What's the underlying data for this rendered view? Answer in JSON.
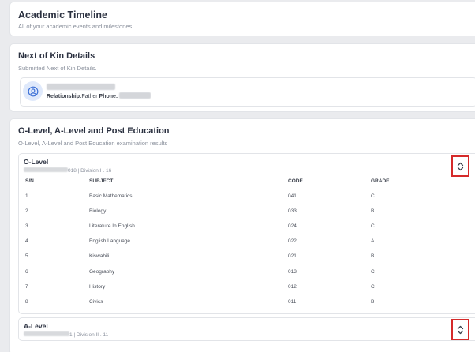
{
  "timeline": {
    "title": "Academic Timeline",
    "subtitle": "All of your academic events and milestones"
  },
  "kin": {
    "title": "Next of Kin Details",
    "subtitle": "Submitted Next of Kin Details.",
    "relationship_label": "Relationship:",
    "relationship_value": "Father",
    "phone_label": "Phone:",
    "icon": "user-circle-icon"
  },
  "education": {
    "title": "O-Level, A-Level and Post Education",
    "subtitle": "O-Level, A-Level and Post Education examination results",
    "olevel": {
      "title": "O-Level",
      "index_suffix": "018",
      "division_text": "| Division:I . 16",
      "headers": {
        "sn": "S/N",
        "subject": "SUBJECT",
        "code": "CODE",
        "grade": "GRADE"
      },
      "rows": [
        {
          "sn": "1",
          "subject": "Basic Mathematics",
          "code": "041",
          "grade": "C"
        },
        {
          "sn": "2",
          "subject": "Biology",
          "code": "033",
          "grade": "B"
        },
        {
          "sn": "3",
          "subject": "Literature In English",
          "code": "024",
          "grade": "C"
        },
        {
          "sn": "4",
          "subject": "English Language",
          "code": "022",
          "grade": "A"
        },
        {
          "sn": "5",
          "subject": "Kiswahili",
          "code": "021",
          "grade": "B"
        },
        {
          "sn": "6",
          "subject": "Geography",
          "code": "013",
          "grade": "C"
        },
        {
          "sn": "7",
          "subject": "History",
          "code": "012",
          "grade": "C"
        },
        {
          "sn": "8",
          "subject": "Civics",
          "code": "011",
          "grade": "B"
        }
      ]
    },
    "alevel": {
      "title": "A-Level",
      "index_suffix": "1",
      "division_text": "| Division:II . 11"
    }
  },
  "colors": {
    "highlight_border": "#d52a2a",
    "avatar_bg": "#dfe9fb",
    "avatar_icon": "#3b6fd6"
  }
}
